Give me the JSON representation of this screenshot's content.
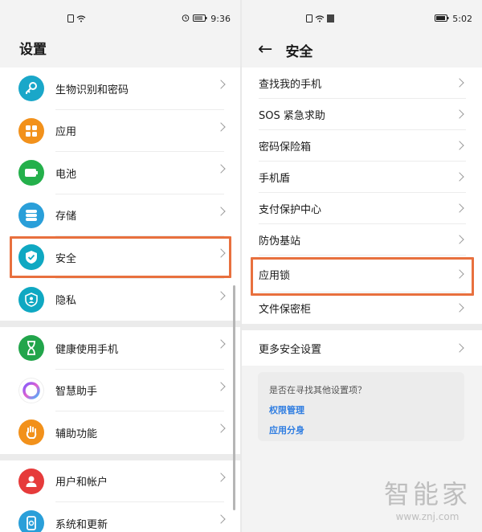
{
  "left": {
    "status_time": "9:36",
    "title": "设置",
    "groups": [
      [
        {
          "label": "生物识别和密码",
          "color": "#1aa7c9",
          "icon": "key-icon"
        },
        {
          "label": "应用",
          "color": "#f2911b",
          "icon": "apps-grid-icon"
        },
        {
          "label": "电池",
          "color": "#24b04b",
          "icon": "battery-icon"
        },
        {
          "label": "存储",
          "color": "#2a9fd9",
          "icon": "storage-icon"
        },
        {
          "label": "安全",
          "color": "#0fa8c2",
          "icon": "shield-check-icon"
        },
        {
          "label": "隐私",
          "color": "#0fa8c2",
          "icon": "privacy-icon"
        }
      ],
      [
        {
          "label": "健康使用手机",
          "color": "#22a54b",
          "icon": "hourglass-icon"
        },
        {
          "label": "智慧助手",
          "color": "#ffffff",
          "icon": "assistant-ring-icon"
        },
        {
          "label": "辅助功能",
          "color": "#f2911b",
          "icon": "hand-icon"
        }
      ],
      [
        {
          "label": "用户和帐户",
          "color": "#e63b3b",
          "icon": "user-icon"
        },
        {
          "label": "系统和更新",
          "color": "#2a9fd9",
          "icon": "phone-update-icon"
        }
      ]
    ]
  },
  "right": {
    "status_time": "5:02",
    "title": "安全",
    "items": [
      "查找我的手机",
      "SOS 紧急求助",
      "密码保险箱",
      "手机盾",
      "支付保护中心",
      "防伪基站",
      "应用锁",
      "文件保密柜"
    ],
    "more": "更多安全设置",
    "suggest": {
      "question": "是否在寻找其他设置项？",
      "links": [
        "权限管理",
        "应用分身"
      ]
    }
  },
  "watermark": {
    "brand": "智能家",
    "url": "www.znj.com"
  },
  "highlight_color": "#e8703e"
}
